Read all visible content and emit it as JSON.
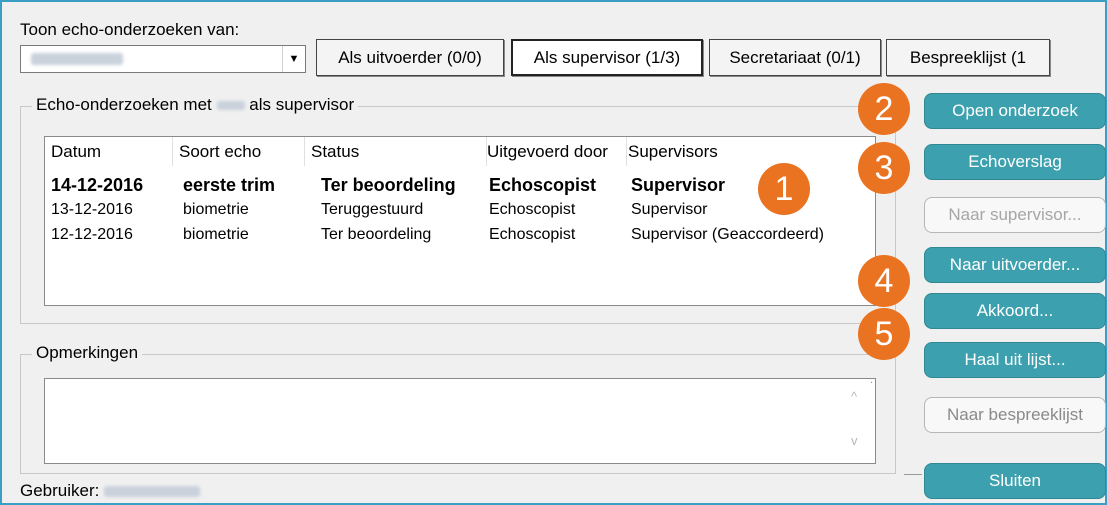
{
  "filter": {
    "label": "Toon echo-onderzoeken van:",
    "tabs": [
      "Als uitvoerder (0/0)",
      "Als supervisor (1/3)",
      "Secretariaat (0/1)",
      "Bespreeklijst (1"
    ]
  },
  "exams_group": {
    "title_prefix": "Echo-onderzoeken met",
    "title_suffix": "als supervisor"
  },
  "table": {
    "columns": [
      "Datum",
      "Soort echo",
      "Status",
      "Uitgevoerd door",
      "Supervisors"
    ],
    "rows": [
      [
        "14-12-2016",
        "eerste trim",
        "Ter beoordeling",
        "Echoscopist",
        "Supervisor"
      ],
      [
        "13-12-2016",
        "biometrie",
        "Teruggestuurd",
        "Echoscopist",
        "Supervisor"
      ],
      [
        "12-12-2016",
        "biometrie",
        "Ter beoordeling",
        "Echoscopist",
        "Supervisor (Geaccordeerd)"
      ]
    ]
  },
  "remarks": {
    "title": "Opmerkingen",
    "value": ""
  },
  "user": {
    "label": "Gebruiker:"
  },
  "buttons": {
    "open": "Open onderzoek",
    "report": "Echoverslag",
    "to_supervisor": "Naar supervisor...",
    "to_executor": "Naar uitvoerder...",
    "approve": "Akkoord...",
    "remove": "Haal uit lijst...",
    "to_discussion": "Naar bespreeklijst",
    "close": "Sluiten"
  },
  "badges": [
    "1",
    "2",
    "3",
    "4",
    "5"
  ],
  "colors": {
    "teal_button": "#3ca0ae",
    "badge": "#ea7322",
    "frame": "#3a9fc4"
  }
}
